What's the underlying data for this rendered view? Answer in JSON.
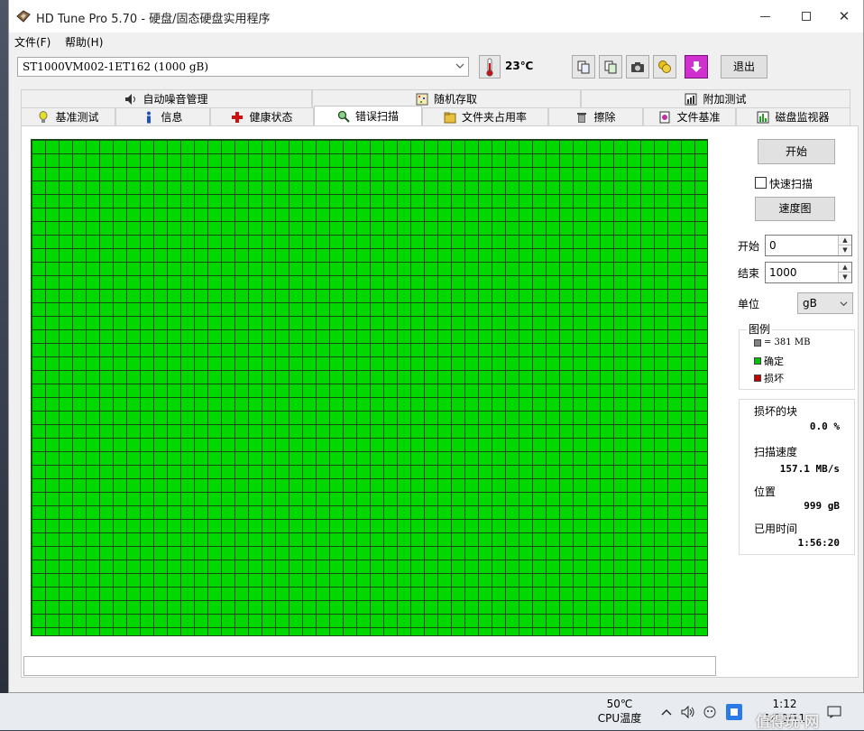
{
  "window": {
    "title": "HD Tune Pro 5.70 - 硬盘/固态硬盘实用程序"
  },
  "menu": {
    "file": "文件(F)",
    "help": "帮助(H)"
  },
  "toolbar": {
    "drive": "ST1000VM002-1ET162 (1000 gB)",
    "temperature": "23℃",
    "exit_label": "退出"
  },
  "tabs_row1": [
    {
      "label": "自动噪音管理",
      "icon": "speaker-icon"
    },
    {
      "label": "随机存取",
      "icon": "random-access-icon"
    },
    {
      "label": "附加测试",
      "icon": "extra-tests-icon"
    }
  ],
  "tabs_row2": [
    {
      "label": "基准测试",
      "icon": "benchmark-icon"
    },
    {
      "label": "信息",
      "icon": "info-icon"
    },
    {
      "label": "健康状态",
      "icon": "health-cross-icon"
    },
    {
      "label": "错误扫描",
      "icon": "magnifier-icon",
      "active": true
    },
    {
      "label": "文件夹占用率",
      "icon": "folder-icon"
    },
    {
      "label": "擦除",
      "icon": "trash-icon"
    },
    {
      "label": "文件基准",
      "icon": "file-benchmark-icon"
    },
    {
      "label": "磁盘监视器",
      "icon": "disk-monitor-icon"
    }
  ],
  "scan": {
    "start_button": "开始",
    "quick_scan_label": "快速扫描",
    "quick_scan_checked": false,
    "speed_map_button": "速度图",
    "start_label": "开始",
    "start_value": "0",
    "end_label": "结束",
    "end_value": "1000",
    "unit_label": "单位",
    "unit_value": "gB",
    "block_color": "#00d800",
    "grid_line_color": "#1a4a1a"
  },
  "legend": {
    "title": "图例",
    "block_size": "= 381 MB",
    "ok": "确定",
    "damaged": "损坏",
    "colors": {
      "block": "#808080",
      "ok": "#00c000",
      "damaged": "#c00000"
    }
  },
  "stats": {
    "damaged_blocks_label": "损坏的块",
    "damaged_blocks_value": "0.0 %",
    "scan_speed_label": "扫描速度",
    "scan_speed_value": "157.1 MB/s",
    "position_label": "位置",
    "position_value": "999 gB",
    "elapsed_label": "已用时间",
    "elapsed_value": "1:56:20"
  },
  "taskbar": {
    "cpu_temp_value": "50℃",
    "cpu_temp_label": "CPU温度",
    "clock_time": "1:12",
    "clock_date": "1/10/11",
    "watermark": "值得玩·网"
  }
}
